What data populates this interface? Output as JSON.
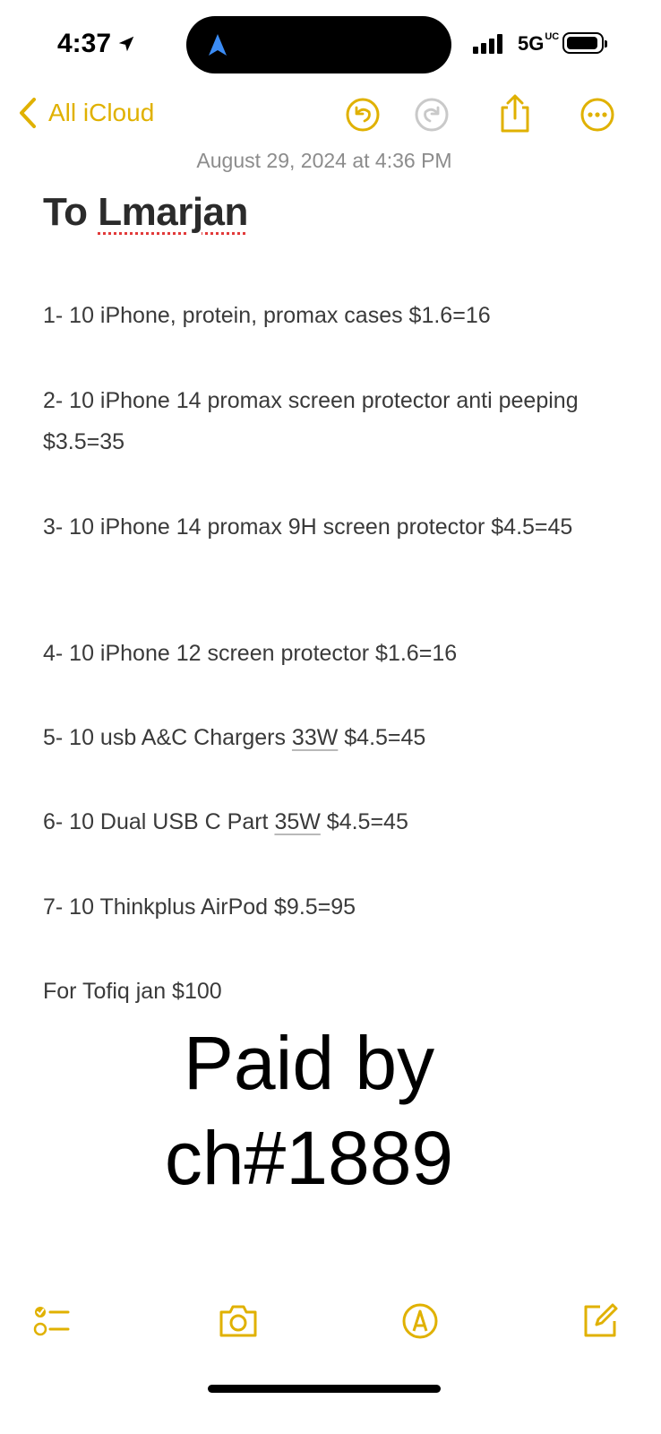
{
  "status_bar": {
    "time": "4:37",
    "network": "5G",
    "network_sup": "UC"
  },
  "nav": {
    "back_label": "All iCloud"
  },
  "note": {
    "date": "August 29, 2024 at 4:36 PM",
    "title_prefix": "To ",
    "title_name": "Lmarjan",
    "items": [
      {
        "text": "1- 10 iPhone, protein, promax cases $1.6=16"
      },
      {
        "text": "2- 10 iPhone 14 promax screen protector anti peeping $3.5=35"
      },
      {
        "text": "3- 10 iPhone 14 promax 9H screen protector $4.5=45"
      },
      {
        "text": "4- 10 iPhone 12 screen protector $1.6=16"
      },
      {
        "before": "5- 10 usb A&C Chargers ",
        "detected": "33W",
        "after": " $4.5=45"
      },
      {
        "before": "6- 10 Dual USB C Part ",
        "detected": "35W",
        "after": " $4.5=45"
      },
      {
        "text": "7- 10 Thinkplus AirPod $9.5=95"
      },
      {
        "text": "For Tofiq jan $100"
      }
    ],
    "stamp_line1": "Paid by",
    "stamp_line2": "ch#1889"
  },
  "toolbar": {
    "icons": [
      "checklist-icon",
      "camera-icon",
      "markup-icon",
      "compose-icon"
    ]
  },
  "colors": {
    "accent": "#e0b100",
    "accent_disabled": "#c9c9c9",
    "text": "#3a3a3a",
    "date": "#8c8c8c",
    "background": "#ffffff"
  }
}
